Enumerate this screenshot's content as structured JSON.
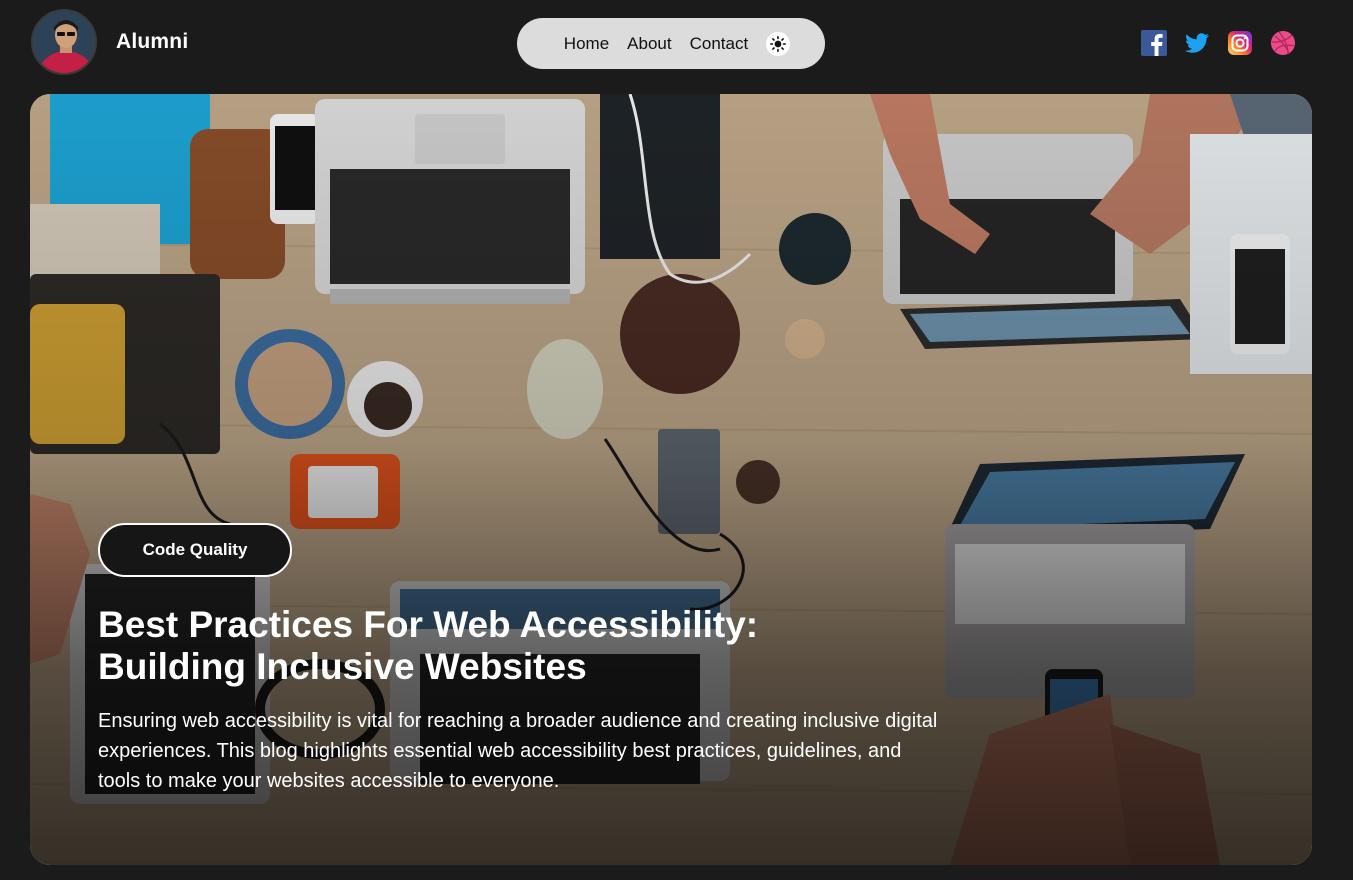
{
  "header": {
    "brand": "Alumni",
    "nav": [
      {
        "label": "Home"
      },
      {
        "label": "About"
      },
      {
        "label": "Contact"
      }
    ],
    "theme_icon": "sun-icon",
    "social": [
      {
        "icon": "facebook-icon",
        "color": "#3b5998"
      },
      {
        "icon": "twitter-icon",
        "color": "#1da1f2"
      },
      {
        "icon": "instagram-icon",
        "color": "#e1306c"
      },
      {
        "icon": "dribbble-icon",
        "color": "#ea4c89"
      }
    ]
  },
  "hero": {
    "tag": "Code Quality",
    "title_line1": "Best Practices For Web Accessibility:",
    "title_line2": "Building Inclusive Websites",
    "description": "Ensuring web accessibility is vital for reaching a broader audience and creating inclusive digital experiences. This blog highlights essential web accessibility best practices, guidelines, and tools to make your websites accessible to everyone."
  }
}
